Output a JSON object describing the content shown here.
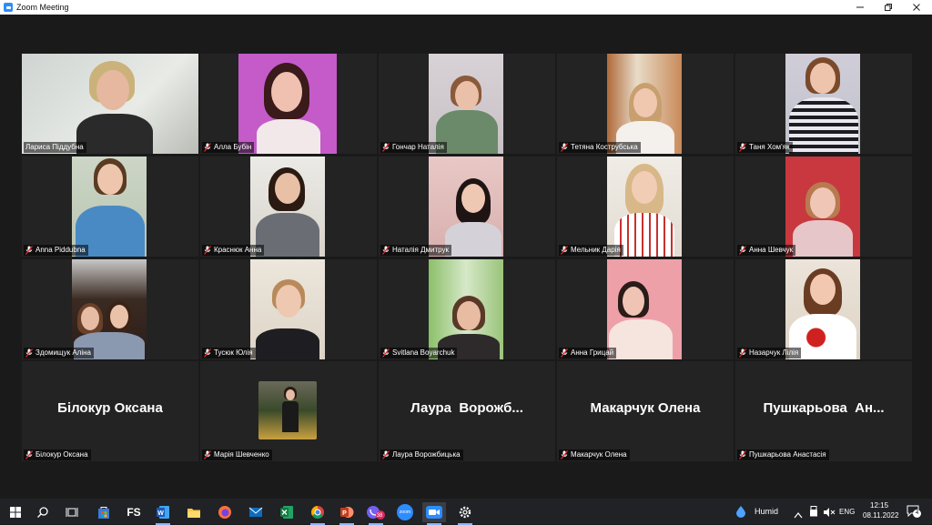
{
  "window": {
    "title": "Zoom Meeting",
    "accent": "#2d8cff",
    "active_speaker_color": "#c7e35b"
  },
  "participants": [
    {
      "name": "Лариса Піддубна",
      "muted": false,
      "video": true,
      "active": true
    },
    {
      "name": "Алла Бубін",
      "muted": true,
      "video": true
    },
    {
      "name": "Гончар Наталія",
      "muted": true,
      "video": true
    },
    {
      "name": "Тетяна Кострубська",
      "muted": true,
      "video": true
    },
    {
      "name": "Таня Хом'як",
      "muted": true,
      "video": true
    },
    {
      "name": "Anna Piddubna",
      "muted": true,
      "video": true
    },
    {
      "name": "Краснюк Анна",
      "muted": true,
      "video": true
    },
    {
      "name": "Наталія Дмитрук",
      "muted": true,
      "video": true
    },
    {
      "name": "Мельник Дарія",
      "muted": true,
      "video": true
    },
    {
      "name": "Анна Шевчук",
      "muted": true,
      "video": true
    },
    {
      "name": "Здомищук Аліна",
      "muted": true,
      "video": true
    },
    {
      "name": "Тусюк Юлія",
      "muted": true,
      "video": true
    },
    {
      "name": "Svitlana Boyarchuk",
      "muted": true,
      "video": true
    },
    {
      "name": "Анна Грицай",
      "muted": true,
      "video": true
    },
    {
      "name": "Назарчук Лілія",
      "muted": true,
      "video": true
    },
    {
      "name": "Білокур Оксана",
      "muted": true,
      "video": false,
      "display_name": "Білокур Оксана"
    },
    {
      "name": "Марія Шевченко",
      "muted": true,
      "video": true
    },
    {
      "name": "Лаура Ворожбицька",
      "muted": true,
      "video": false,
      "display_name": "Лаура  Ворожб..."
    },
    {
      "name": "Макарчук Олена",
      "muted": true,
      "video": false,
      "display_name": "Макарчук Олена"
    },
    {
      "name": "Пушкарьова Анастасія",
      "muted": true,
      "video": false,
      "display_name": "Пушкарьова  Ан..."
    }
  ],
  "taskbar": {
    "apps": [
      "start-icon",
      "search-icon",
      "task-view-icon",
      "store-icon",
      "fs-app",
      "word-icon",
      "file-explorer-icon",
      "firefox-icon",
      "mail-icon",
      "excel-icon",
      "chrome-icon",
      "powerpoint-icon",
      "viber-icon",
      "zoom-app-icon",
      "zoom-meeting-icon",
      "settings-icon"
    ],
    "fs_label": "FS",
    "zoom_label": "zoom",
    "viber_badge": "38",
    "weather": "Humid",
    "language": "ENG",
    "time": "12:15",
    "date": "08.11.2022",
    "notifications": "4"
  }
}
